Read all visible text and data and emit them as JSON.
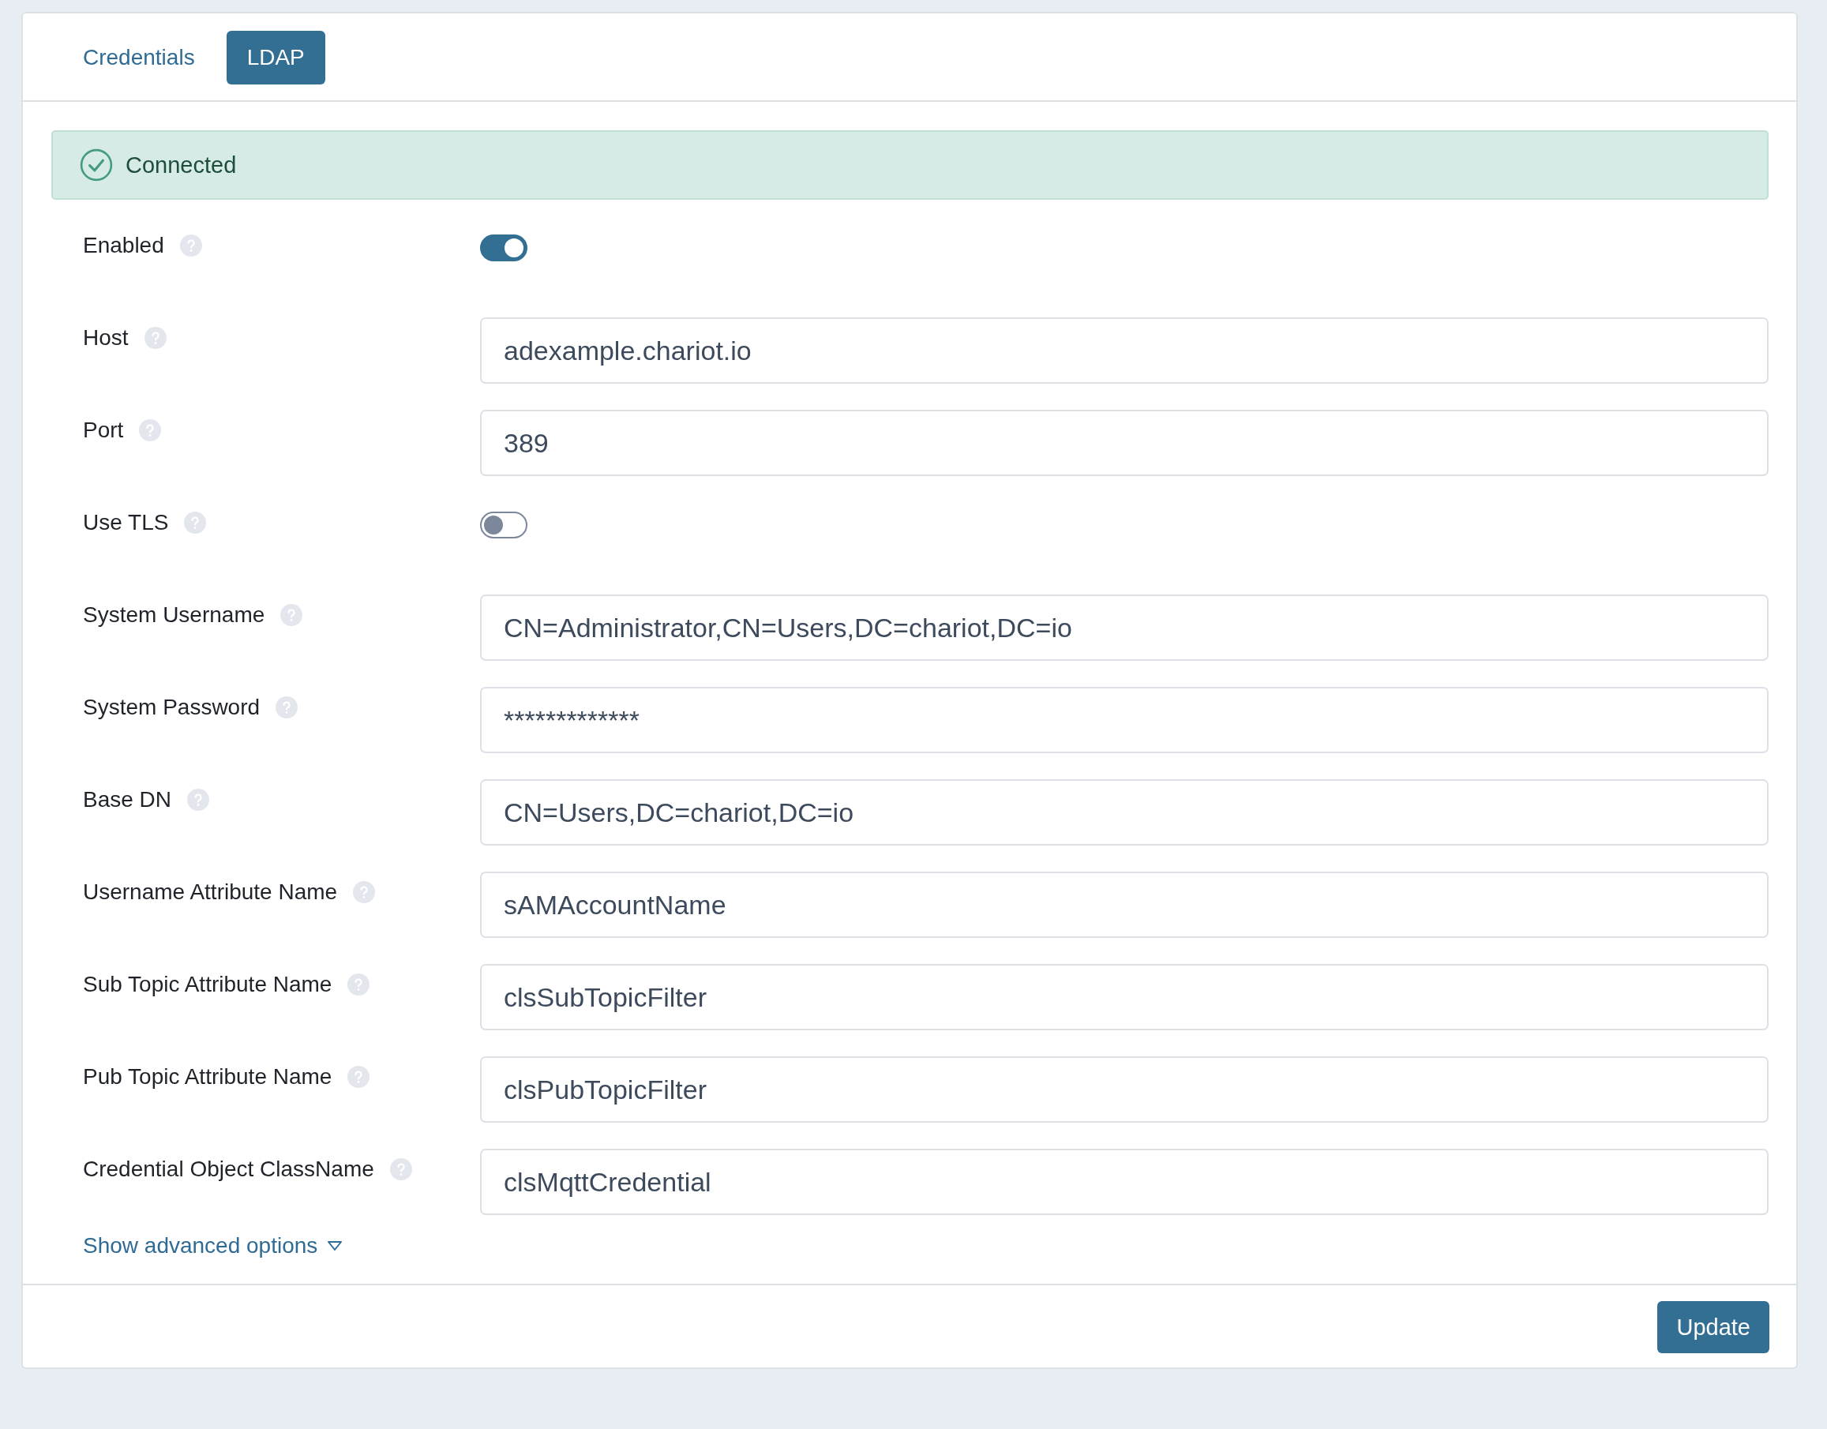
{
  "tabs": [
    {
      "label": "Credentials",
      "selected": false
    },
    {
      "label": "LDAP",
      "selected": true
    }
  ],
  "status": {
    "text": "Connected"
  },
  "fields": [
    {
      "kind": "toggle",
      "label": "Enabled",
      "on": true
    },
    {
      "kind": "text",
      "label": "Host",
      "value": "adexample.chariot.io"
    },
    {
      "kind": "text",
      "label": "Port",
      "value": "389"
    },
    {
      "kind": "toggle",
      "label": "Use TLS",
      "on": false
    },
    {
      "kind": "text",
      "label": "System Username",
      "value": "CN=Administrator,CN=Users,DC=chariot,DC=io"
    },
    {
      "kind": "text",
      "label": "System Password",
      "value": "*************"
    },
    {
      "kind": "text",
      "label": "Base DN",
      "value": "CN=Users,DC=chariot,DC=io"
    },
    {
      "kind": "text",
      "label": "Username Attribute Name",
      "value": "sAMAccountName"
    },
    {
      "kind": "text",
      "label": "Sub Topic Attribute Name",
      "value": "clsSubTopicFilter"
    },
    {
      "kind": "text",
      "label": "Pub Topic Attribute Name",
      "value": "clsPubTopicFilter"
    },
    {
      "kind": "text",
      "label": "Credential Object ClassName",
      "value": "clsMqttCredential"
    }
  ],
  "advanced_link": "Show advanced options",
  "buttons": [
    "Update"
  ]
}
